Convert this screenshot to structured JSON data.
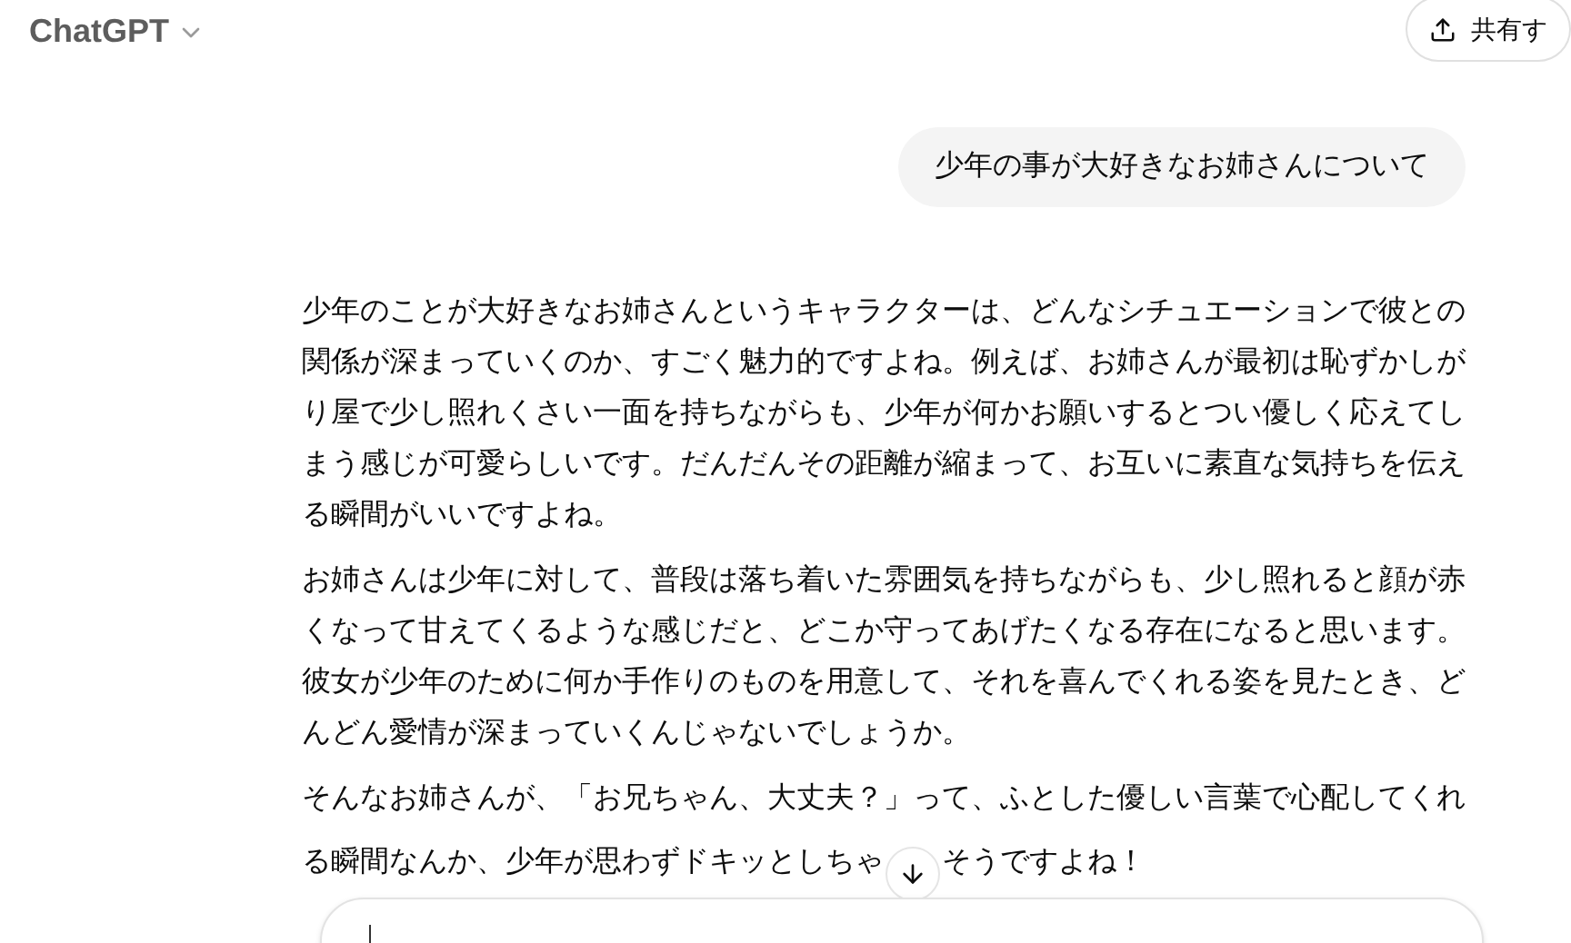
{
  "header": {
    "model": "ChatGPT",
    "share": "共有す"
  },
  "user_message": "少年の事が大好きなお姉さんについて",
  "assistant_paragraphs": [
    "少年のことが大好きなお姉さんというキャラクターは、どんなシチュエーションで彼との関係が深まっていくのか、すごく魅力的ですよね。例えば、お姉さんが最初は恥ずかしがり屋で少し照れくさい一面を持ちながらも、少年が何かお願いするとつい優しく応えてしまう感じが可愛らしいです。だんだんその距離が縮まって、お互いに素直な気持ちを伝える瞬間がいいですよね。",
    "お姉さんは少年に対して、普段は落ち着いた雰囲気を持ちながらも、少し照れると顔が赤くなって甘えてくるような感じだと、どこか守ってあげたくなる存在になると思います。彼女が少年のために何か手作りのものを用意して、それを喜んでくれる姿を見たとき、どんどん愛情が深まっていくんじゃないでしょうか。"
  ],
  "last_paragraph": {
    "first_line": "そんなお姉さんが、「お兄ちゃん、大丈夫？」って、ふとした優しい言葉で心配してくれ",
    "before": "る瞬間なんか、少年が思わずドキッとしちゃ",
    "after": "そうですよね！"
  }
}
